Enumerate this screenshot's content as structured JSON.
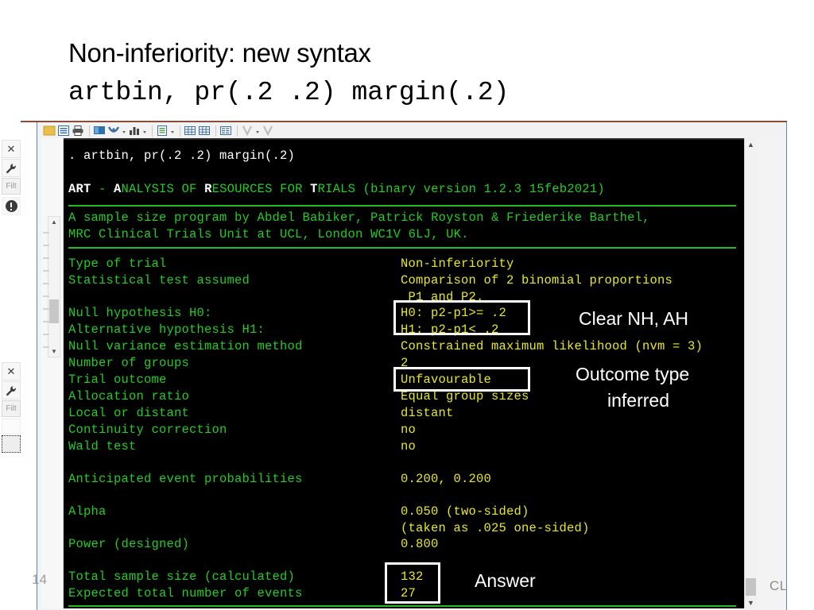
{
  "slide": {
    "title": "Non-inferiority: new syntax",
    "subtitle": "artbin, pr(.2 .2) margin(.2)",
    "page_number": "14",
    "corner_mark": "CL"
  },
  "toolbar": {
    "icons": [
      "folder-open-icon",
      "log-file-icon",
      "print-icon",
      "graph-window-icon",
      "graph-editor-icon",
      "bar-chart-icon",
      "do-file-editor-icon",
      "data-editor-icon",
      "data-browser-icon",
      "variables-manager-icon",
      "break-icon",
      "stop-icon"
    ]
  },
  "left_strip": {
    "close_label": "✕",
    "settings_label": "ᵕ",
    "filter_label": "Filt",
    "alert_icon": "exclamation-circle-icon",
    "scroll_up": "▲",
    "scroll_down": "▼"
  },
  "terminal": {
    "scroll_up": "▲",
    "scroll_down": "▼",
    "command_line": ". artbin, pr(.2 .2) margin(.2)",
    "banner": {
      "art": "ART",
      "dash": " - ",
      "a": "A",
      "nalysis": "NALYSIS OF ",
      "r": "R",
      "esources": "ESOURCES FOR ",
      "t": "T",
      "rials": "RIALS ",
      "version": "(binary version 1.2.3 15feb2021)"
    },
    "credit_line_1": "A sample size program by Abdel Babiker, Patrick Royston & Friederike Barthel,",
    "credit_line_2": "MRC Clinical Trials Unit at UCL, London WC1V 6LJ, UK.",
    "labels": [
      "Type of trial",
      "Statistical test assumed",
      "Null hypothesis H0:",
      "Alternative hypothesis H1:",
      "Null variance estimation method",
      "Number of groups",
      "Trial outcome",
      "Allocation ratio",
      "Local or distant",
      "Continuity correction",
      "Wald test",
      "Anticipated event probabilities",
      "Alpha",
      "Power (designed)",
      "Total sample size (calculated)",
      "Expected total number of events"
    ],
    "values": {
      "type_of_trial": "Non-inferiority",
      "test_assumed_1": "Comparison of 2 binomial proportions",
      "test_assumed_2": " P1 and P2.",
      "h0": "H0: p2-p1>= .2",
      "h1": "H1: p2-p1< .2",
      "null_variance": "Constrained maximum likelihood (nvm = 3)",
      "number_of_groups": "2",
      "trial_outcome": "Unfavourable",
      "allocation_ratio": "Equal group sizes",
      "local_or_distant": "distant",
      "continuity_correction": "no",
      "wald_test": "no",
      "anticipated_probabilities": "0.200, 0.200",
      "alpha_1": "0.050 (two-sided)",
      "alpha_2": "(taken as .025 one-sided)",
      "power": "0.800",
      "total_sample_size": "132",
      "expected_events": "27"
    }
  },
  "annotations": {
    "clear_nh_ah": "Clear NH, AH",
    "outcome_type_line1": "Outcome type",
    "outcome_type_line2": "inferred",
    "answer": "Answer"
  },
  "colors": {
    "terminal_bg": "#000000",
    "label_green": "#22cc22",
    "value_yellow": "#e8e822",
    "command_white": "#ffffff",
    "rule_green": "#22bb22",
    "annotation_white": "#ffffff",
    "title_rule": "#8b4a3a"
  }
}
